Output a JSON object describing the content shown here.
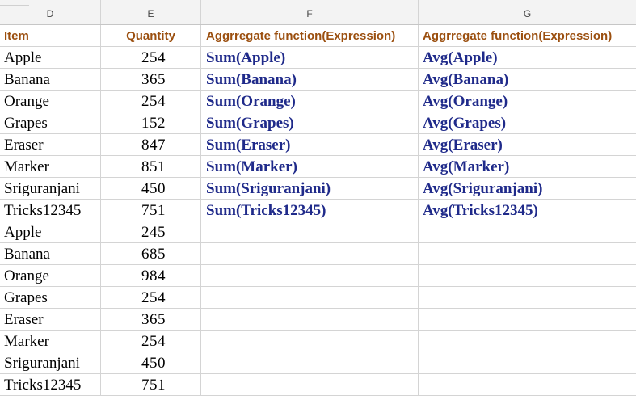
{
  "columns": [
    "D",
    "E",
    "F",
    "G"
  ],
  "header_row": {
    "item": "Item",
    "quantity": "Quantity",
    "f_header": "Aggrregate function(Expression)",
    "g_header": "Aggrregate function(Expression)"
  },
  "rows": [
    {
      "item": "Apple",
      "quantity": "254",
      "sum": "Sum(Apple)",
      "avg": "Avg(Apple)"
    },
    {
      "item": "Banana",
      "quantity": "365",
      "sum": "Sum(Banana)",
      "avg": "Avg(Banana)"
    },
    {
      "item": "Orange",
      "quantity": "254",
      "sum": "Sum(Orange)",
      "avg": "Avg(Orange)"
    },
    {
      "item": "Grapes",
      "quantity": "152",
      "sum": "Sum(Grapes)",
      "avg": "Avg(Grapes)"
    },
    {
      "item": "Eraser",
      "quantity": "847",
      "sum": "Sum(Eraser)",
      "avg": "Avg(Eraser)"
    },
    {
      "item": "Marker",
      "quantity": "851",
      "sum": "Sum(Marker)",
      "avg": "Avg(Marker)"
    },
    {
      "item": "Sriguranjani",
      "quantity": "450",
      "sum": "Sum(Sriguranjani)",
      "avg": "Avg(Sriguranjani)"
    },
    {
      "item": "Tricks12345",
      "quantity": "751",
      "sum": "Sum(Tricks12345)",
      "avg": "Avg(Tricks12345)"
    },
    {
      "item": "Apple",
      "quantity": "245",
      "sum": "",
      "avg": ""
    },
    {
      "item": "Banana",
      "quantity": "685",
      "sum": "",
      "avg": ""
    },
    {
      "item": "Orange",
      "quantity": "984",
      "sum": "",
      "avg": ""
    },
    {
      "item": "Grapes",
      "quantity": "254",
      "sum": "",
      "avg": ""
    },
    {
      "item": "Eraser",
      "quantity": "365",
      "sum": "",
      "avg": ""
    },
    {
      "item": "Marker",
      "quantity": "254",
      "sum": "",
      "avg": ""
    },
    {
      "item": "Sriguranjani",
      "quantity": "450",
      "sum": "",
      "avg": ""
    },
    {
      "item": "Tricks12345",
      "quantity": "751",
      "sum": "",
      "avg": ""
    }
  ]
}
